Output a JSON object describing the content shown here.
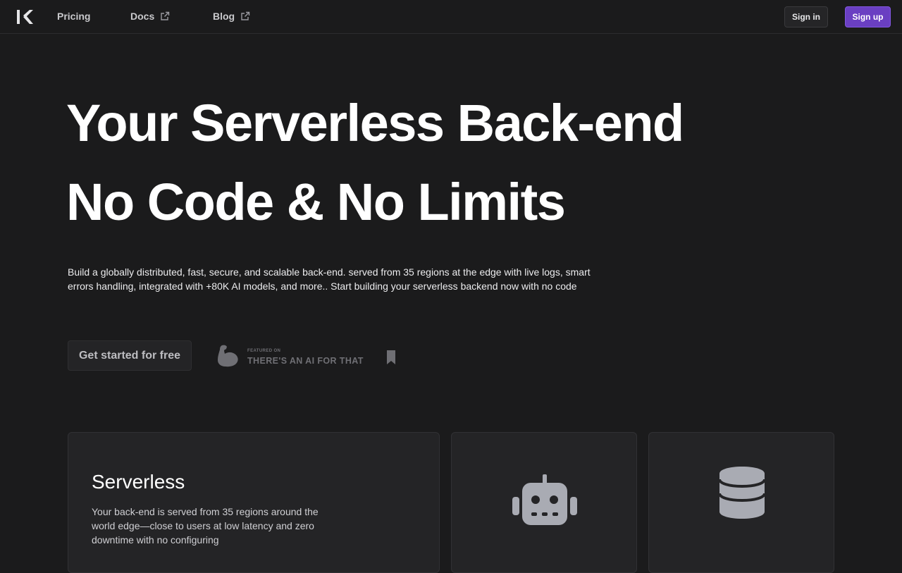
{
  "nav": {
    "pricing": "Pricing",
    "docs": "Docs",
    "blog": "Blog",
    "sign_in": "Sign in",
    "sign_up": "Sign up"
  },
  "hero": {
    "line1": "Your Serverless Back-end",
    "line2": "No Code & No Limits",
    "description": "Build a globally distributed, fast, secure, and scalable back-end. served from 35 regions at the edge with live logs, smart errors handling, integrated with +80K AI models, and more.. Start building your serverless backend now with no code",
    "cta": "Get started for free"
  },
  "featured": {
    "small": "FEATURED ON",
    "big": "THERE'S AN AI FOR THAT"
  },
  "cards": {
    "serverless_title": "Serverless",
    "serverless_text": "Your back-end is served from 35 regions around the world edge—close to users at low latency and zero downtime with no configuring"
  },
  "colors": {
    "background": "#1b1b1c",
    "accent": "#6a3fc2",
    "card": "#242426"
  }
}
